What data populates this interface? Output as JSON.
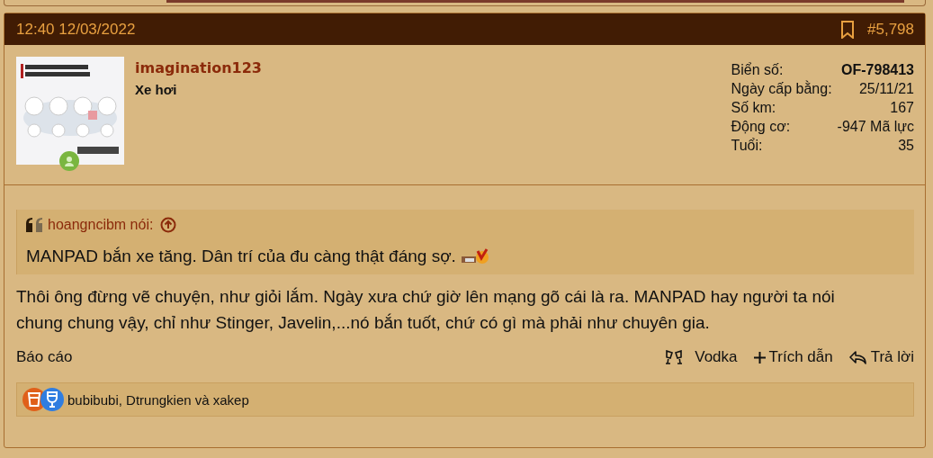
{
  "post": {
    "time": "12:40 12/03/2022",
    "number": "#5,798",
    "bookmarked": false
  },
  "author": {
    "online": true,
    "username": "imagination123",
    "title": "Xe hơi"
  },
  "stats": [
    {
      "label": "Biển số:",
      "value": "OF-798413",
      "bold": true
    },
    {
      "label": "Ngày cấp bằng:",
      "value": "25/11/21",
      "bold": false
    },
    {
      "label": "Số km:",
      "value": "167",
      "bold": false
    },
    {
      "label": "Động cơ:",
      "value": "-947 Mã lực",
      "bold": false
    },
    {
      "label": "Tuổi:",
      "value": "35",
      "bold": false
    }
  ],
  "quote": {
    "author": "hoangncibm nói:",
    "text": "MANPAD bắn xe tăng. Dân trí của đu càng thật đáng sợ."
  },
  "message": "Thôi ông đừng vẽ chuyện, như giỏi lắm. Ngày xưa chứ giờ lên mạng gõ cái là ra. MANPAD hay người ta nói chung chung vậy, chỉ như Stinger, Javelin,...nó bắn tuốt, chứ có gì mà phải như chuyên gia.",
  "report": "Báo cáo",
  "actions": [
    {
      "kind": "vodka",
      "label": "Vodka"
    },
    {
      "kind": "quote",
      "label": "Trích dẫn"
    },
    {
      "kind": "reply",
      "label": "Trả lời"
    }
  ],
  "reactions": {
    "icons": [
      {
        "kind": "beer",
        "color": "#e0601a"
      },
      {
        "kind": "wine",
        "color": "#2f7de0"
      }
    ],
    "users": "bubibubi, Dtrungkien và xakep"
  }
}
